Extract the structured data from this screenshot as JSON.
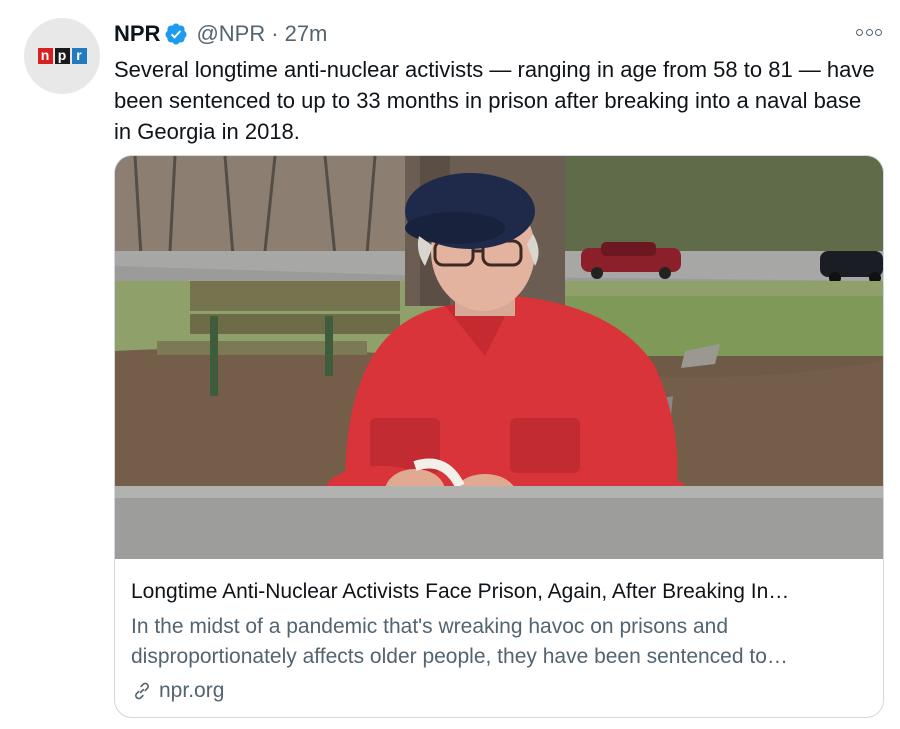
{
  "account": {
    "name": "NPR",
    "handle": "@NPR",
    "separator": "·",
    "time": "27m",
    "avatar_logo": [
      "n",
      "p",
      "r"
    ],
    "verified": true
  },
  "tweet": {
    "text": "Several longtime anti-nuclear activists — ranging in age from 58 to 81 — have been sentenced to up to 33 months in prison after breaking into a naval base in Georgia in 2018."
  },
  "card": {
    "title": "Longtime Anti-Nuclear Activists Face Prison, Again, After Breaking In…",
    "description": "In the midst of a pandemic that's wreaking havoc on prisons and disproportionately affects older people, they have been sentenced to…",
    "domain": "npr.org"
  },
  "icons": {
    "verified": "verified-badge-icon",
    "more": "more-options-icon",
    "link": "link-icon"
  },
  "colors": {
    "verified_blue": "#1d9bf0",
    "secondary_text": "#536471",
    "npr_red": "#d62021",
    "npr_black": "#1a1a1a",
    "npr_blue": "#237bbd"
  }
}
